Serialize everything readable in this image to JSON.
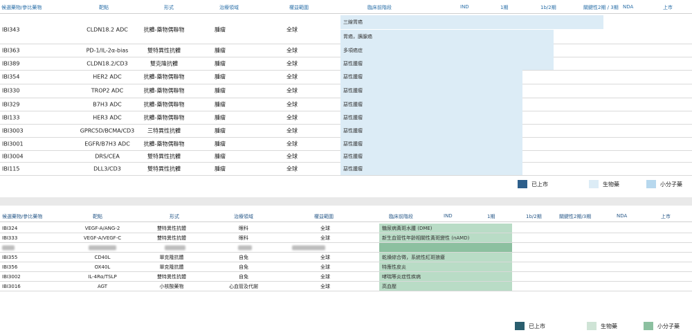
{
  "top": {
    "headers": [
      "候選藥物/參比藥物",
      "靶點",
      "形式",
      "治療領域",
      "權益範圍",
      "臨床前階段",
      "IND",
      "1期",
      "1b/2期",
      "關鍵性2期 / 3期",
      "NDA",
      "上市"
    ],
    "rows": [
      {
        "name": "IBI343",
        "target": "CLDN18.2 ADC",
        "form": "抗體-藥物偶聯物",
        "area": "腫瘤",
        "rights": "全球",
        "bars": [
          {
            "label": "三線胃癌",
            "to": 872
          },
          {
            "label": "胃癌，胰腺癌",
            "to": 800
          }
        ]
      },
      {
        "name": "IBI363",
        "target": "PD-1/IL-2α-bias",
        "form": "雙特異性抗體",
        "area": "腫瘤",
        "rights": "全球",
        "bars": [
          {
            "label": "多項癌症",
            "to": 800
          }
        ]
      },
      {
        "name": "IBI389",
        "target": "CLDN18.2/CD3",
        "form": "雙克隆抗體",
        "area": "腫瘤",
        "rights": "全球",
        "bars": [
          {
            "label": "惡性腫瘤",
            "to": 800
          }
        ]
      },
      {
        "name": "IBI354",
        "target": "HER2 ADC",
        "form": "抗體-藥物偶聯物",
        "area": "腫瘤",
        "rights": "全球",
        "bars": [
          {
            "label": "惡性腫瘤",
            "to": 755
          }
        ]
      },
      {
        "name": "IBI330",
        "target": "TROP2 ADC",
        "form": "抗體-藥物偶聯物",
        "area": "腫瘤",
        "rights": "全球",
        "bars": [
          {
            "label": "惡性腫瘤",
            "to": 755
          }
        ]
      },
      {
        "name": "IBI329",
        "target": "B7H3 ADC",
        "form": "抗體-藥物偶聯物",
        "area": "腫瘤",
        "rights": "全球",
        "bars": [
          {
            "label": "惡性腫瘤",
            "to": 755
          }
        ]
      },
      {
        "name": "IBI133",
        "target": "HER3 ADC",
        "form": "抗體-藥物偶聯物",
        "area": "腫瘤",
        "rights": "全球",
        "bars": [
          {
            "label": "惡性腫瘤",
            "to": 755
          }
        ]
      },
      {
        "name": "IBI3003",
        "target": "GPRC5D/BCMA/CD3",
        "form": "三特異性抗體",
        "area": "腫瘤",
        "rights": "全球",
        "bars": [
          {
            "label": "惡性腫瘤",
            "to": 755
          }
        ]
      },
      {
        "name": "IBI3001",
        "target": "EGFR/B7H3 ADC",
        "form": "抗體-藥物偶聯物",
        "area": "腫瘤",
        "rights": "全球",
        "bars": [
          {
            "label": "惡性腫瘤",
            "to": 755
          }
        ]
      },
      {
        "name": "IBI3004",
        "target": "DRS/CEA",
        "form": "雙特異性抗體",
        "area": "腫瘤",
        "rights": "全球",
        "bars": [
          {
            "label": "惡性腫瘤",
            "to": 755
          }
        ]
      },
      {
        "name": "IBI115",
        "target": "DLL3/CD3",
        "form": "雙特異性抗體",
        "area": "腫瘤",
        "rights": "全球",
        "bars": [
          {
            "label": "惡性腫瘤",
            "to": 755
          }
        ]
      }
    ],
    "legend": [
      {
        "label": "已上市",
        "color": "#2d5f8b"
      },
      {
        "label": "生物藥",
        "color": "#dcecf6"
      },
      {
        "label": "小分子藥",
        "color": "#b7d8ee"
      }
    ],
    "bar_color": "#dcecf6"
  },
  "bottom": {
    "headers": [
      "候選藥物/參比藥物",
      "靶點",
      "形式",
      "治療領域",
      "權益範圍",
      "臨床前階段",
      "IND",
      "1期",
      "1b/2期",
      "關鍵性2期/3期",
      "NDA",
      "上市"
    ],
    "rows": [
      {
        "name": "IBI324",
        "target": "VEGF-A/ANG-2",
        "form": "雙特異性抗體",
        "area": "眼科",
        "rights": "全球",
        "bar": "糖尿病黃斑水腫 (DME)",
        "to": 740
      },
      {
        "name": "IBI333",
        "target": "VEGF-A/VEGF-C",
        "form": "雙特異性抗體",
        "area": "眼科",
        "rights": "全球",
        "bar": "新生血管性年齡相關性黃斑變性 (nAMD)",
        "to": 740
      },
      {
        "name": "",
        "target": "",
        "form": "",
        "area": "",
        "rights": "",
        "bar": "",
        "to": 740,
        "blurred": true
      },
      {
        "name": "IBI355",
        "target": "CD40L",
        "form": "單克隆抗體",
        "area": "自免",
        "rights": "全球",
        "bar": "乾燥綜合徵，系統性紅斑狼瘡",
        "to": 740
      },
      {
        "name": "IBI356",
        "target": "OX40L",
        "form": "單克隆抗體",
        "area": "自免",
        "rights": "全球",
        "bar": "特應性皮炎",
        "to": 740
      },
      {
        "name": "IBI3002",
        "target": "IL-4Rα/TSLP",
        "form": "雙特異性抗體",
        "area": "自免",
        "rights": "全球",
        "bar": "哮喘等炎症性疾病",
        "to": 740
      },
      {
        "name": "IBI3016",
        "target": "AGT",
        "form": "小核酸藥物",
        "area": "心血管及代謝",
        "rights": "全球",
        "bar": "高血壓",
        "to": 740
      }
    ],
    "legend": [
      {
        "label": "已上市",
        "color": "#2a5e6e"
      },
      {
        "label": "生物藥",
        "color": "#cfe4d6"
      },
      {
        "label": "小分子藥",
        "color": "#8cc0a0"
      }
    ],
    "bar_color": "#b9dcc6",
    "blur_bar_color": "#8cc0a0"
  }
}
